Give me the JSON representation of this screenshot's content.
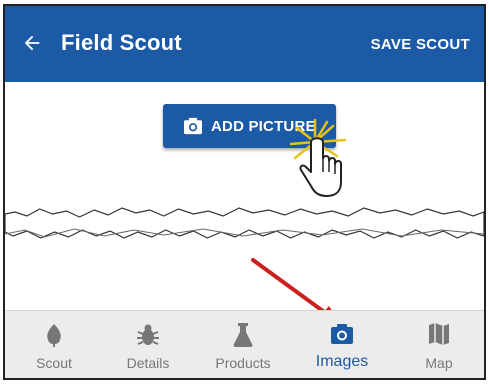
{
  "appbar": {
    "title": "Field Scout",
    "action_label": "SAVE SCOUT",
    "back_icon": "arrow-left-icon"
  },
  "main": {
    "add_picture_label": "ADD PICTURE",
    "add_picture_icon": "camera-icon"
  },
  "bottom_nav": {
    "active": "Images",
    "items": [
      {
        "label": "Scout",
        "icon": "leaf-icon"
      },
      {
        "label": "Details",
        "icon": "bug-icon"
      },
      {
        "label": "Products",
        "icon": "flask-icon"
      },
      {
        "label": "Images",
        "icon": "camera-icon"
      },
      {
        "label": "Map",
        "icon": "map-icon"
      }
    ]
  },
  "colors": {
    "primary": "#1d5aa5",
    "nav_background": "#ececec",
    "nav_inactive": "#777777",
    "annotation_arrow": "#cc1f1f",
    "click_burst": "#e8c21a"
  }
}
